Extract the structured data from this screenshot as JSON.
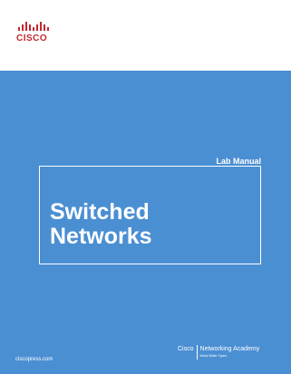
{
  "brand": {
    "logo_text": "CISCO",
    "logo_color": "#c4262e"
  },
  "cover": {
    "background_top": "#ffffff",
    "background_main": "#4b8fd3",
    "text_color": "#ffffff",
    "subtitle": "Lab Manual",
    "title_line1": "Switched",
    "title_line2": "Networks",
    "publisher": "ciscopress.com",
    "academy_left": "Cisco",
    "academy_name": "Networking Academy",
    "academy_tagline": "Mind Wide Open"
  }
}
